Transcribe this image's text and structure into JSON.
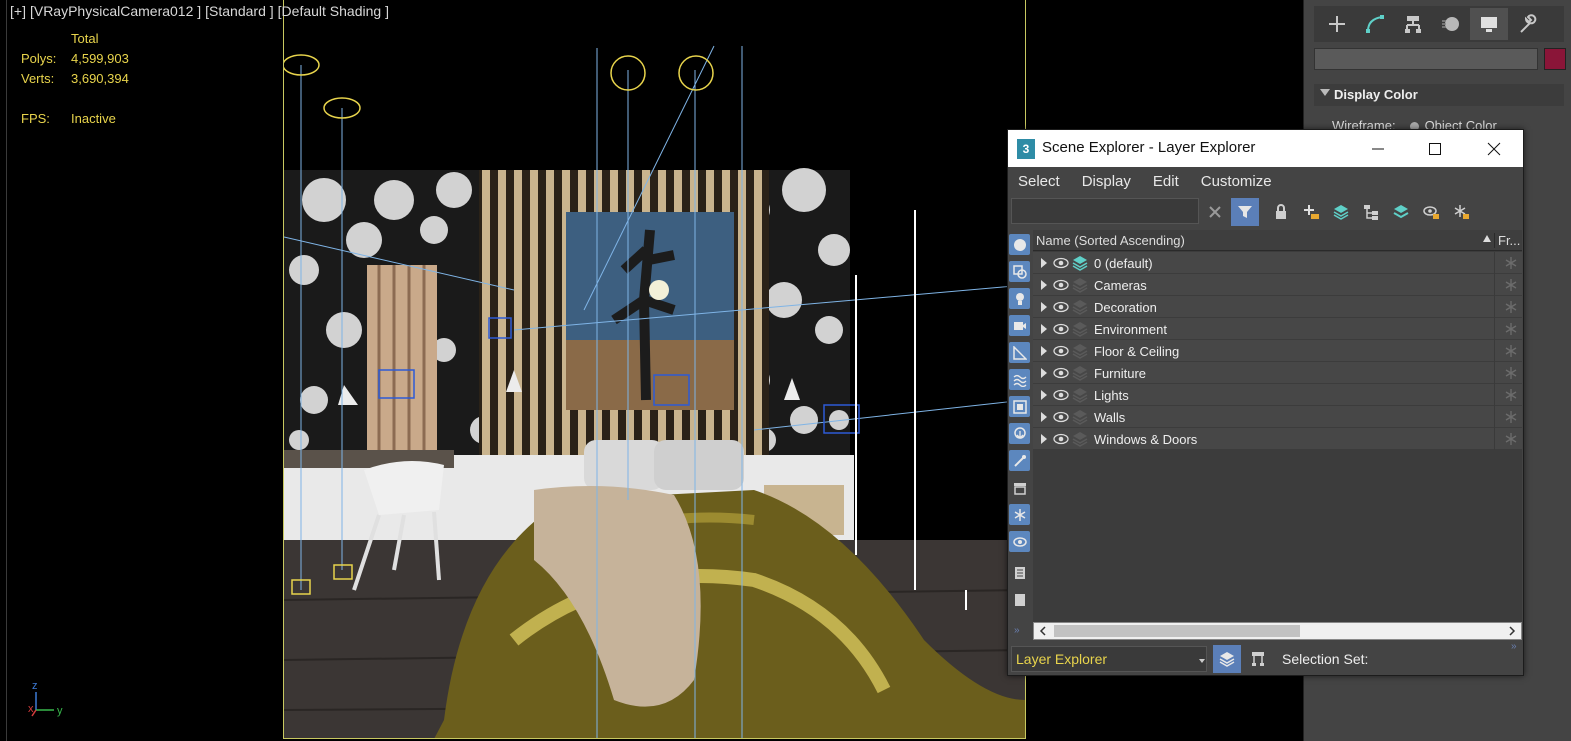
{
  "viewport": {
    "label_parts": [
      "[+]",
      "[VRayPhysicalCamera012 ]",
      "[Standard ]",
      "[Default Shading ]"
    ],
    "stats": {
      "header": "Total",
      "polys_label": "Polys:",
      "polys_value": "4,599,903",
      "verts_label": "Verts:",
      "verts_value": "3,690,394",
      "fps_label": "FPS:",
      "fps_value": "Inactive"
    },
    "axis": {
      "z": "z",
      "x": "x",
      "y": "y"
    }
  },
  "command_panel": {
    "tabs": [
      {
        "icon": "plus-icon"
      },
      {
        "icon": "modify-icon"
      },
      {
        "icon": "hierarchy-icon"
      },
      {
        "icon": "motion-icon"
      },
      {
        "icon": "display-icon"
      },
      {
        "icon": "utilities-icon"
      }
    ],
    "object_color": "#8a1538",
    "rollout_title": "Display Color",
    "wireframe_label": "Wireframe:",
    "wireframe_option": "Object Color"
  },
  "scene_explorer": {
    "title": "Scene Explorer - Layer Explorer",
    "menus": [
      "Select",
      "Display",
      "Edit",
      "Customize"
    ],
    "search_value": "",
    "columns": {
      "name": "Name (Sorted Ascending)",
      "frozen": "Fr..."
    },
    "layers": [
      {
        "name": "0 (default)",
        "active": true
      },
      {
        "name": "Cameras",
        "active": false
      },
      {
        "name": "Decoration",
        "active": false
      },
      {
        "name": "Environment",
        "active": false
      },
      {
        "name": "Floor & Ceiling",
        "active": false
      },
      {
        "name": "Furniture",
        "active": false
      },
      {
        "name": "Lights",
        "active": false
      },
      {
        "name": "Walls",
        "active": false
      },
      {
        "name": "Windows & Doors",
        "active": false
      }
    ],
    "explorer_name": "Layer Explorer",
    "selection_set_label": "Selection Set:",
    "accent_color": "#5b7fb8"
  }
}
